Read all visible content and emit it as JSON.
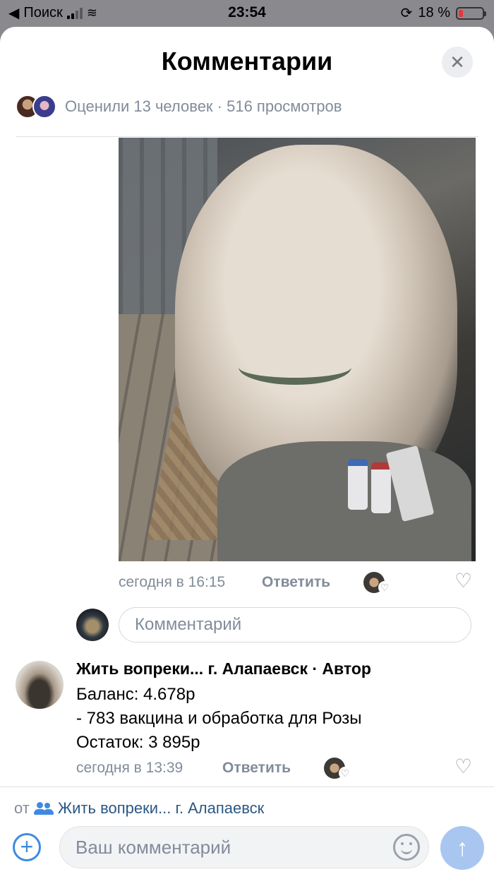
{
  "status_bar": {
    "back_app": "Поиск",
    "time": "23:54",
    "battery": "18 %",
    "battery_level": 0.18
  },
  "header": {
    "title": "Комментарии",
    "close_icon": "close-icon"
  },
  "post_stats": {
    "text": "Оценили 13 человек · 516 просмотров"
  },
  "photo_comment": {
    "time": "сегодня в 16:15",
    "reply_label": "Ответить"
  },
  "reply_input": {
    "placeholder": "Комментарий"
  },
  "comment": {
    "author": "Жить вопреки... г. Алапаевск",
    "author_tag": "· Автор",
    "lines": [
      "Баланс: 4.678р",
      "- 783 вакцина и обработка для Розы",
      "Остаток: 3 895р"
    ],
    "time": "сегодня в 13:39",
    "reply_label": "Ответить"
  },
  "composer": {
    "from_label": "от",
    "from_group": "Жить вопреки... г. Алапаевск",
    "placeholder": "Ваш комментарий"
  },
  "colors": {
    "accent": "#3f8ae0",
    "secondary_text": "#818c99",
    "battery_low": "#e8363b"
  }
}
